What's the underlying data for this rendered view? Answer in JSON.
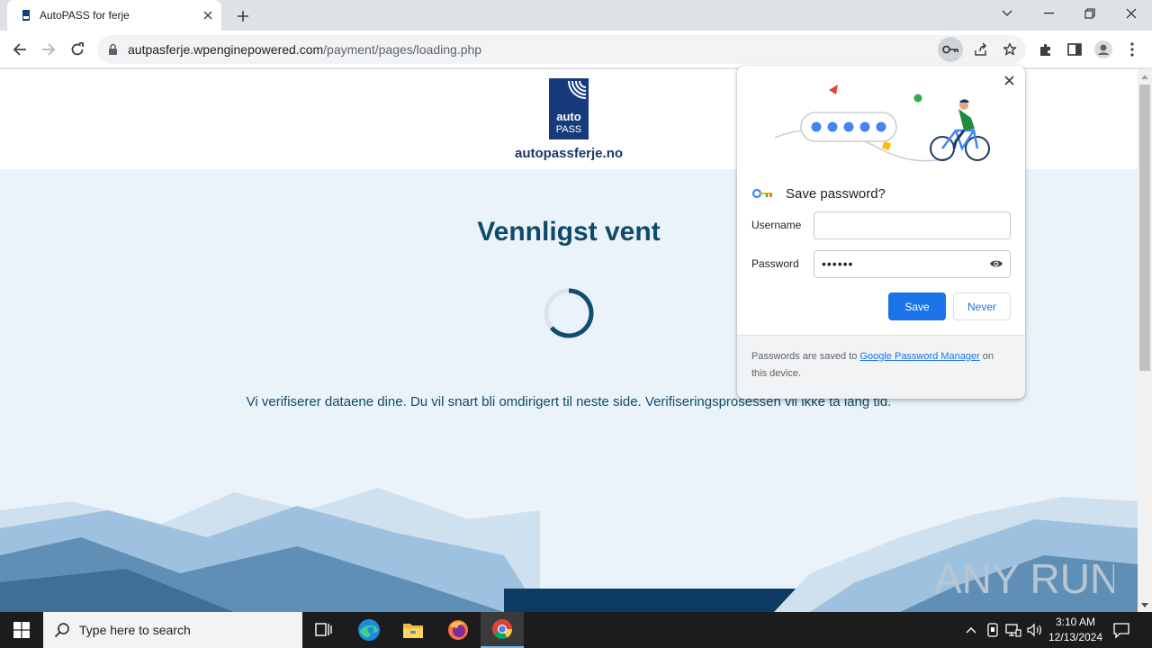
{
  "browser": {
    "tab_title": "AutoPASS for ferje",
    "url_host": "autpasferje.wpenginepowered.com",
    "url_path": "/payment/pages/loading.php"
  },
  "page": {
    "logo_line1": "auto",
    "logo_line2": "PASS",
    "logo_domain": "autopassferje.no",
    "heading": "Vennligst vent",
    "message": "Vi verifiserer dataene dine. Du vil snart bli omdirigert til neste side. Verifiseringsprosessen vil ikke ta lang tid."
  },
  "password_bubble": {
    "title": "Save password?",
    "username_label": "Username",
    "username_value": "",
    "password_label": "Password",
    "password_value": "••••••",
    "save_label": "Save",
    "never_label": "Never",
    "footer_prefix": "Passwords are saved to ",
    "footer_link": "Google Password Manager",
    "footer_suffix": " on this device."
  },
  "taskbar": {
    "search_placeholder": "Type here to search",
    "time": "3:10 AM",
    "date": "12/13/2024"
  },
  "watermark": "ANY RUN",
  "colors": {
    "brand_navy": "#173b7a",
    "heading_blue": "#0f4a6b",
    "page_bg": "#eaf3fa",
    "chrome_blue": "#1a73e8"
  }
}
